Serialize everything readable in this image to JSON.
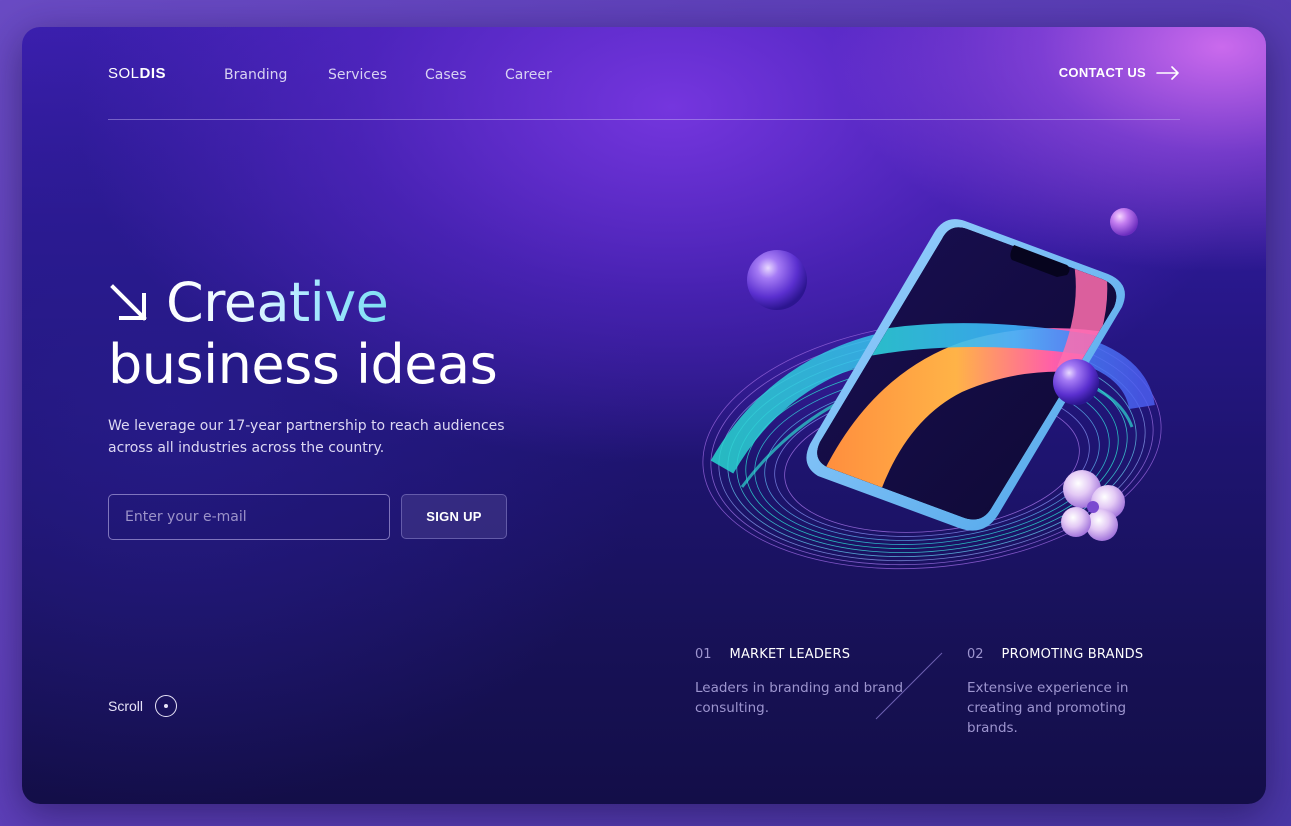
{
  "brand": {
    "logo_light": "SOL",
    "logo_bold": "DIS"
  },
  "nav": {
    "items": [
      {
        "label": "Branding"
      },
      {
        "label": "Services"
      },
      {
        "label": "Cases"
      },
      {
        "label": "Career"
      }
    ],
    "contact_label": "CONTACT US"
  },
  "hero": {
    "title_word": "Creative",
    "title_line2": "business ideas",
    "description": "We leverage our 17-year partnership to reach audiences across all industries across the country.",
    "email_placeholder": "Enter your e-mail",
    "signup_label": "SIGN UP"
  },
  "scroll": {
    "label": "Scroll"
  },
  "features": [
    {
      "number": "01",
      "title": "MARKET LEADERS",
      "description": "Leaders in branding and brand consulting."
    },
    {
      "number": "02",
      "title": "PROMOTING BRANDS",
      "description": "Extensive experience in creating and promoting brands."
    }
  ],
  "colors": {
    "accent_cyan": "#7fe0f2",
    "frame_dark": "#171156",
    "frame_purple": "#7a3ae0",
    "frame_pink": "#d26ef0"
  }
}
